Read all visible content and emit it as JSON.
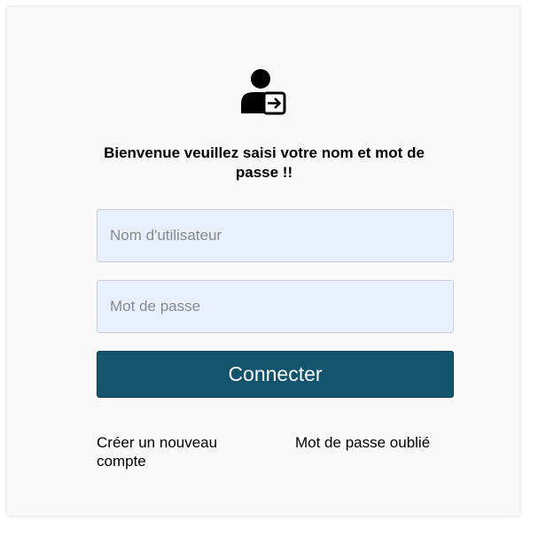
{
  "header": {
    "icon": "user-login-icon",
    "welcome_text": "Bienvenue veuillez saisi votre nom et mot de passe !!"
  },
  "form": {
    "username_placeholder": "Nom d'utilisateur",
    "password_placeholder": "Mot de passe",
    "submit_label": "Connecter"
  },
  "links": {
    "create_account": "Créer un nouveau compte",
    "forgot_password": "Mot de passe oublié"
  },
  "colors": {
    "button_background": "#12536e",
    "input_background": "#e8f0fe",
    "card_background": "#f9f9f9"
  }
}
